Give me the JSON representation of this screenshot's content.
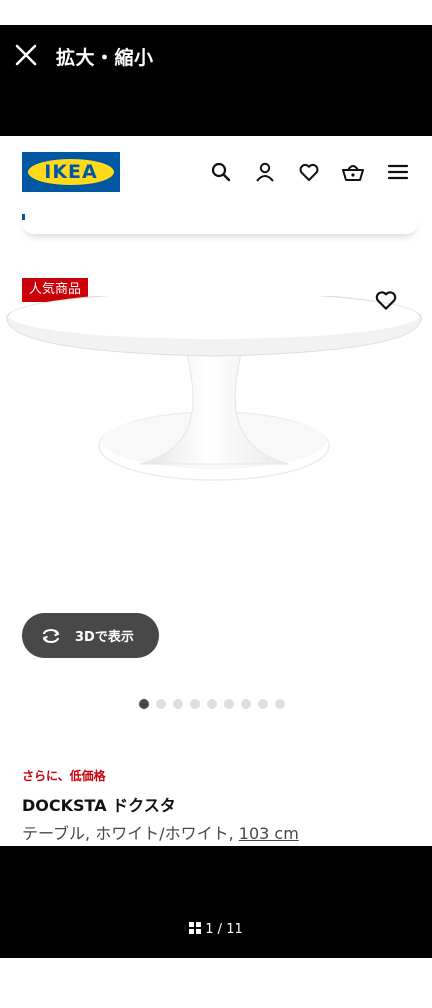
{
  "viewer": {
    "title": "拡大・縮小",
    "page_current": "1",
    "page_total": "11",
    "page_separator": "/"
  },
  "site": {
    "logo_text": "IKEA",
    "header_icons": [
      "search-icon",
      "account-icon",
      "heart-icon",
      "basket-icon",
      "menu-icon"
    ]
  },
  "product": {
    "badge": "人気商品",
    "view_3d_label": "3Dで表示",
    "image_count": 9,
    "active_image_index": 0,
    "promo_text": "さらに、低価格",
    "name": "DOCKSTA ドクスタ",
    "desc_prefix": "テーブル, ホワイト/ホワイト, ",
    "desc_size": "103 cm"
  },
  "colors": {
    "ikea_blue": "#0058a3",
    "ikea_yellow": "#ffda1a",
    "badge_red": "#cc0008",
    "button_dark": "#484848"
  }
}
